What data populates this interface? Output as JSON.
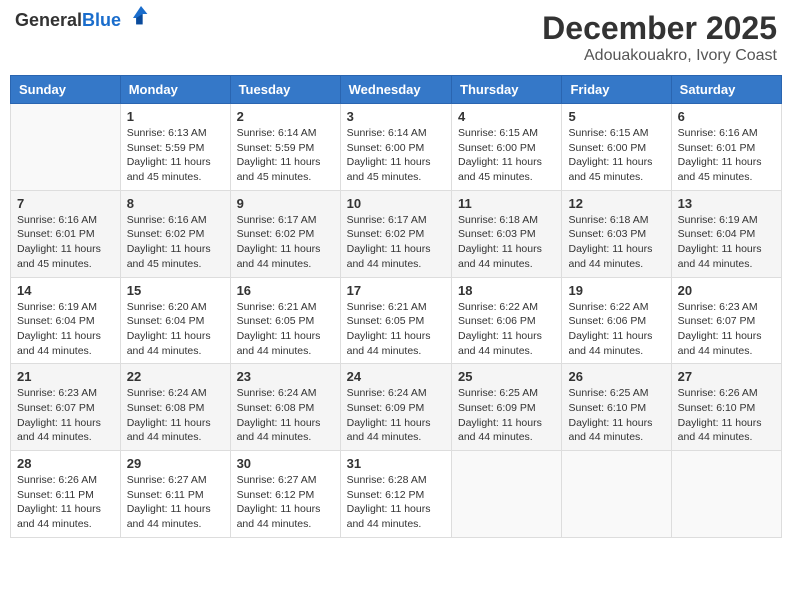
{
  "header": {
    "logo_general": "General",
    "logo_blue": "Blue",
    "month_title": "December 2025",
    "location": "Adouakouakro, Ivory Coast"
  },
  "weekdays": [
    "Sunday",
    "Monday",
    "Tuesday",
    "Wednesday",
    "Thursday",
    "Friday",
    "Saturday"
  ],
  "weeks": [
    [
      {
        "day": "",
        "info": ""
      },
      {
        "day": "1",
        "info": "Sunrise: 6:13 AM\nSunset: 5:59 PM\nDaylight: 11 hours\nand 45 minutes."
      },
      {
        "day": "2",
        "info": "Sunrise: 6:14 AM\nSunset: 5:59 PM\nDaylight: 11 hours\nand 45 minutes."
      },
      {
        "day": "3",
        "info": "Sunrise: 6:14 AM\nSunset: 6:00 PM\nDaylight: 11 hours\nand 45 minutes."
      },
      {
        "day": "4",
        "info": "Sunrise: 6:15 AM\nSunset: 6:00 PM\nDaylight: 11 hours\nand 45 minutes."
      },
      {
        "day": "5",
        "info": "Sunrise: 6:15 AM\nSunset: 6:00 PM\nDaylight: 11 hours\nand 45 minutes."
      },
      {
        "day": "6",
        "info": "Sunrise: 6:16 AM\nSunset: 6:01 PM\nDaylight: 11 hours\nand 45 minutes."
      }
    ],
    [
      {
        "day": "7",
        "info": "Sunrise: 6:16 AM\nSunset: 6:01 PM\nDaylight: 11 hours\nand 45 minutes."
      },
      {
        "day": "8",
        "info": "Sunrise: 6:16 AM\nSunset: 6:02 PM\nDaylight: 11 hours\nand 45 minutes."
      },
      {
        "day": "9",
        "info": "Sunrise: 6:17 AM\nSunset: 6:02 PM\nDaylight: 11 hours\nand 44 minutes."
      },
      {
        "day": "10",
        "info": "Sunrise: 6:17 AM\nSunset: 6:02 PM\nDaylight: 11 hours\nand 44 minutes."
      },
      {
        "day": "11",
        "info": "Sunrise: 6:18 AM\nSunset: 6:03 PM\nDaylight: 11 hours\nand 44 minutes."
      },
      {
        "day": "12",
        "info": "Sunrise: 6:18 AM\nSunset: 6:03 PM\nDaylight: 11 hours\nand 44 minutes."
      },
      {
        "day": "13",
        "info": "Sunrise: 6:19 AM\nSunset: 6:04 PM\nDaylight: 11 hours\nand 44 minutes."
      }
    ],
    [
      {
        "day": "14",
        "info": "Sunrise: 6:19 AM\nSunset: 6:04 PM\nDaylight: 11 hours\nand 44 minutes."
      },
      {
        "day": "15",
        "info": "Sunrise: 6:20 AM\nSunset: 6:04 PM\nDaylight: 11 hours\nand 44 minutes."
      },
      {
        "day": "16",
        "info": "Sunrise: 6:21 AM\nSunset: 6:05 PM\nDaylight: 11 hours\nand 44 minutes."
      },
      {
        "day": "17",
        "info": "Sunrise: 6:21 AM\nSunset: 6:05 PM\nDaylight: 11 hours\nand 44 minutes."
      },
      {
        "day": "18",
        "info": "Sunrise: 6:22 AM\nSunset: 6:06 PM\nDaylight: 11 hours\nand 44 minutes."
      },
      {
        "day": "19",
        "info": "Sunrise: 6:22 AM\nSunset: 6:06 PM\nDaylight: 11 hours\nand 44 minutes."
      },
      {
        "day": "20",
        "info": "Sunrise: 6:23 AM\nSunset: 6:07 PM\nDaylight: 11 hours\nand 44 minutes."
      }
    ],
    [
      {
        "day": "21",
        "info": "Sunrise: 6:23 AM\nSunset: 6:07 PM\nDaylight: 11 hours\nand 44 minutes."
      },
      {
        "day": "22",
        "info": "Sunrise: 6:24 AM\nSunset: 6:08 PM\nDaylight: 11 hours\nand 44 minutes."
      },
      {
        "day": "23",
        "info": "Sunrise: 6:24 AM\nSunset: 6:08 PM\nDaylight: 11 hours\nand 44 minutes."
      },
      {
        "day": "24",
        "info": "Sunrise: 6:24 AM\nSunset: 6:09 PM\nDaylight: 11 hours\nand 44 minutes."
      },
      {
        "day": "25",
        "info": "Sunrise: 6:25 AM\nSunset: 6:09 PM\nDaylight: 11 hours\nand 44 minutes."
      },
      {
        "day": "26",
        "info": "Sunrise: 6:25 AM\nSunset: 6:10 PM\nDaylight: 11 hours\nand 44 minutes."
      },
      {
        "day": "27",
        "info": "Sunrise: 6:26 AM\nSunset: 6:10 PM\nDaylight: 11 hours\nand 44 minutes."
      }
    ],
    [
      {
        "day": "28",
        "info": "Sunrise: 6:26 AM\nSunset: 6:11 PM\nDaylight: 11 hours\nand 44 minutes."
      },
      {
        "day": "29",
        "info": "Sunrise: 6:27 AM\nSunset: 6:11 PM\nDaylight: 11 hours\nand 44 minutes."
      },
      {
        "day": "30",
        "info": "Sunrise: 6:27 AM\nSunset: 6:12 PM\nDaylight: 11 hours\nand 44 minutes."
      },
      {
        "day": "31",
        "info": "Sunrise: 6:28 AM\nSunset: 6:12 PM\nDaylight: 11 hours\nand 44 minutes."
      },
      {
        "day": "",
        "info": ""
      },
      {
        "day": "",
        "info": ""
      },
      {
        "day": "",
        "info": ""
      }
    ]
  ]
}
